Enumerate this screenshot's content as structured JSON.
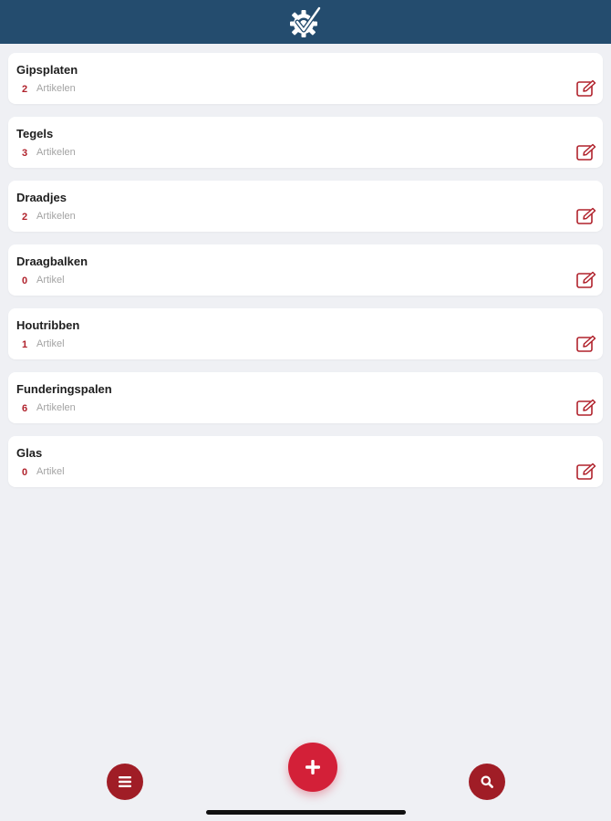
{
  "app": {
    "logo_icon": "gear-check-icon",
    "header_color": "#244c6e"
  },
  "categories": [
    {
      "name": "Gipsplaten",
      "count": "2",
      "unit": "Artikelen"
    },
    {
      "name": "Tegels",
      "count": "3",
      "unit": "Artikelen"
    },
    {
      "name": "Draadjes",
      "count": "2",
      "unit": "Artikelen"
    },
    {
      "name": "Draagbalken",
      "count": "0",
      "unit": "Artikel"
    },
    {
      "name": "Houtribben",
      "count": "1",
      "unit": "Artikel"
    },
    {
      "name": "Funderingspalen",
      "count": "6",
      "unit": "Artikelen"
    },
    {
      "name": "Glas",
      "count": "0",
      "unit": "Artikel"
    }
  ],
  "bottom_bar": {
    "menu_icon": "hamburger-menu-icon",
    "add_icon": "plus-icon",
    "search_icon": "search-icon",
    "accent_color": "#d32038",
    "secondary_color": "#a01d26"
  }
}
